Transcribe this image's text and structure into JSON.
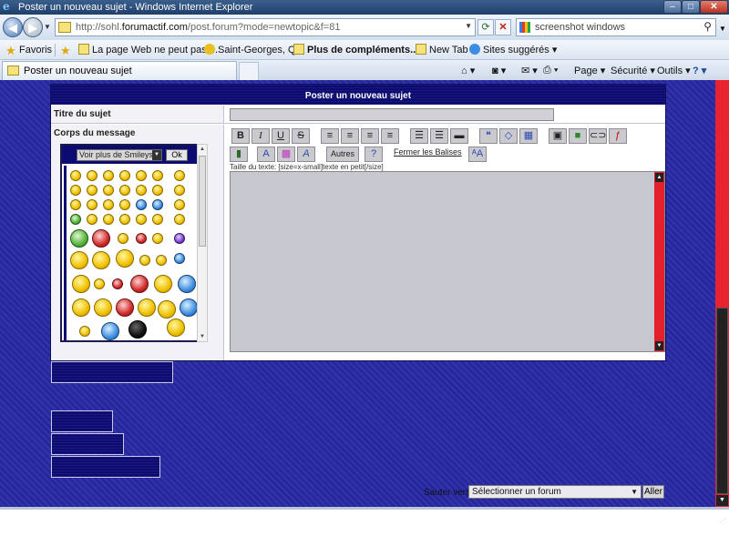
{
  "window": {
    "title": "Poster un nouveau sujet - Windows Internet Explorer"
  },
  "address": {
    "url_prefix": "http://sohl.",
    "url_domain": "forumactif.com",
    "url_suffix": "/post.forum?mode=newtopic&f=81"
  },
  "search": {
    "query": "screenshot windows"
  },
  "favorites": {
    "label": "Favoris",
    "items": [
      "La page Web ne peut pas ...",
      "Saint-Georges, QC",
      "Plus de compléments...",
      "New Tab",
      "Sites suggérés"
    ]
  },
  "tab": {
    "label": "Poster un nouveau sujet"
  },
  "commands": {
    "page": "Page",
    "security": "Sécurité",
    "tools": "Outils"
  },
  "form": {
    "header": "Poster un nouveau sujet",
    "title_label": "Titre du sujet",
    "body_label": "Corps du message",
    "smiley_select": "Voir plus de Smileys",
    "smiley_ok": "Ok",
    "toolbar": {
      "bold": "B",
      "italic": "I",
      "underline": "U",
      "strike": "S",
      "others": "Autres",
      "close_tags": "Fermer les Balises"
    },
    "size_hint": "Taille du texte: [size=x-small]texte en petit[/size]"
  },
  "footer": {
    "jump_label": "Sauter vers:",
    "jump_select": "Sélectionner un forum",
    "jump_button": "Aller"
  },
  "colors": {
    "page_bg": "#2a2aa6",
    "header_navy": "#0b0b72",
    "scrollbar_red": "#e6232f"
  }
}
